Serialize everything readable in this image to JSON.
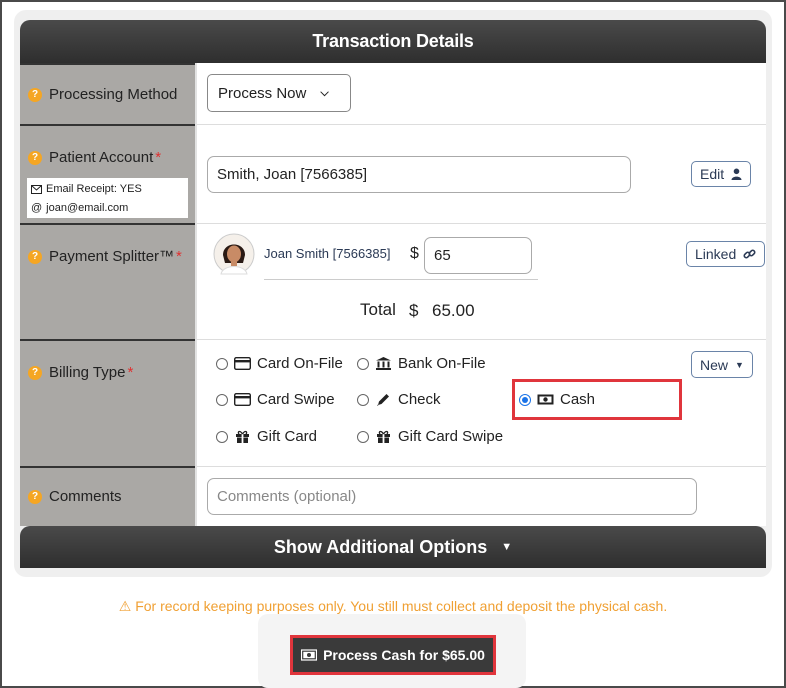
{
  "header": {
    "title": "Transaction Details"
  },
  "processing_method": {
    "label": "Processing Method",
    "selected": "Process Now"
  },
  "patient_account": {
    "label": "Patient Account",
    "value": "Smith, Joan [7566385]",
    "email_receipt": "Email Receipt: YES",
    "email": "joan@email.com",
    "edit_label": "Edit"
  },
  "payment_splitter": {
    "label": "Payment Splitter™",
    "patient_name": "Joan Smith [7566385]",
    "currency": "$",
    "amount": "65",
    "linked_label": "Linked",
    "total_label": "Total",
    "total_currency": "$",
    "total_value": "65.00"
  },
  "billing_type": {
    "label": "Billing Type",
    "new_label": "New",
    "options": [
      {
        "label": "Card On-File",
        "icon": "credit-card-icon"
      },
      {
        "label": "Bank On-File",
        "icon": "bank-icon"
      },
      {
        "label": "Card Swipe",
        "icon": "credit-card-icon"
      },
      {
        "label": "Check",
        "icon": "pen-icon"
      },
      {
        "label": "Cash",
        "icon": "cash-icon",
        "selected": true
      },
      {
        "label": "Gift Card",
        "icon": "gift-icon"
      },
      {
        "label": "Gift Card Swipe",
        "icon": "gift-icon"
      }
    ]
  },
  "comments": {
    "label": "Comments",
    "placeholder": "Comments (optional)"
  },
  "additional_options": {
    "label": "Show Additional Options"
  },
  "warning": {
    "text": "For record keeping purposes only. You still must collect and deposit the physical cash."
  },
  "process_button": {
    "label": "Process Cash for $65.00"
  },
  "colors": {
    "header_bg": "#333333",
    "label_bg": "#aaa8a5",
    "accent_orange": "#f5a623",
    "highlight_red": "#e0353c",
    "radio_blue": "#1a73e8"
  }
}
